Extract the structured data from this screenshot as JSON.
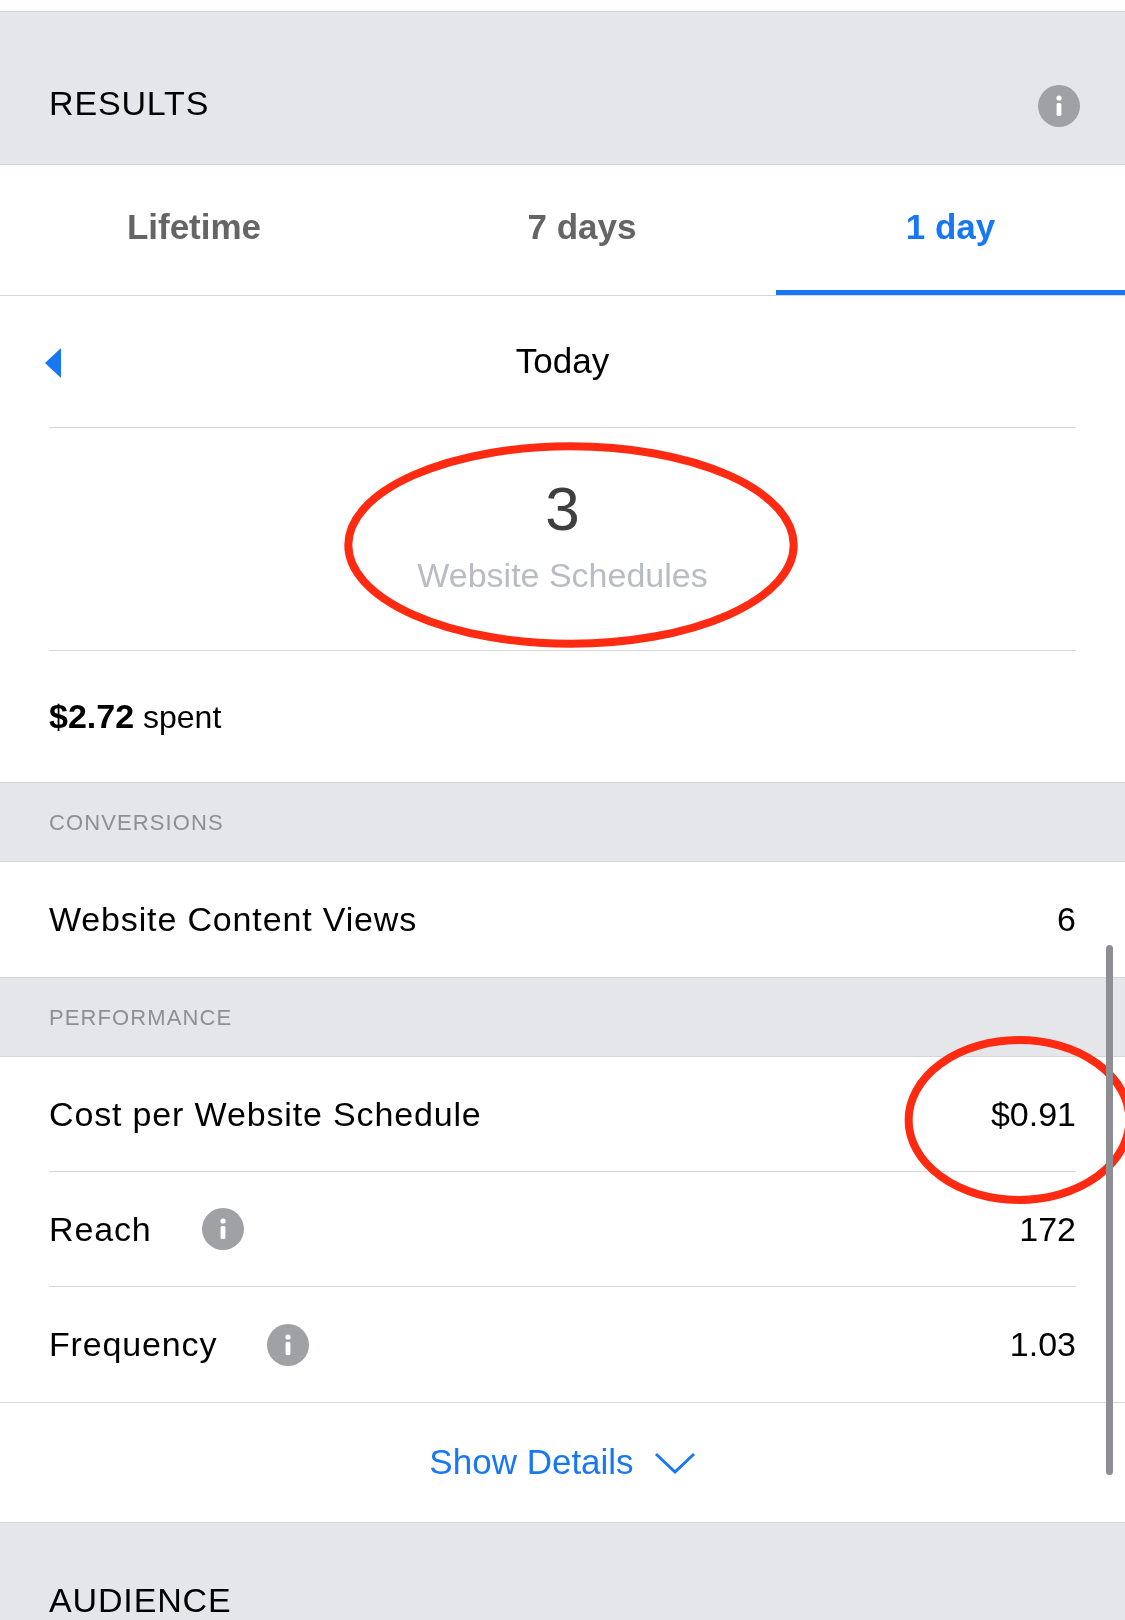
{
  "results_header": {
    "title": "RESULTS"
  },
  "tabs": [
    {
      "label": "Lifetime",
      "selected": false
    },
    {
      "label": "7 days",
      "selected": false
    },
    {
      "label": "1 day",
      "selected": true
    }
  ],
  "period": {
    "label": "Today"
  },
  "result": {
    "value": "3",
    "label": "Website Schedules",
    "highlighted": true
  },
  "spent": "**$2.72** spent",
  "sections": [
    {
      "title": "CONVERSIONS",
      "rows": [
        {
          "label": "Website Content Views",
          "value": "6",
          "info": false,
          "highlighted": false
        }
      ]
    },
    {
      "title": "PERFORMANCE",
      "rows": [
        {
          "label": "Cost per Website Schedule",
          "value": "$0.91",
          "info": false,
          "highlighted": true
        },
        {
          "label": "Reach",
          "value": "172",
          "info": true,
          "highlighted": false
        },
        {
          "label": "Frequency",
          "value": "1.03",
          "info": true,
          "highlighted": false
        }
      ]
    }
  ],
  "show_details": "Show Details",
  "next_header": {
    "title": "AUDIENCE"
  }
}
